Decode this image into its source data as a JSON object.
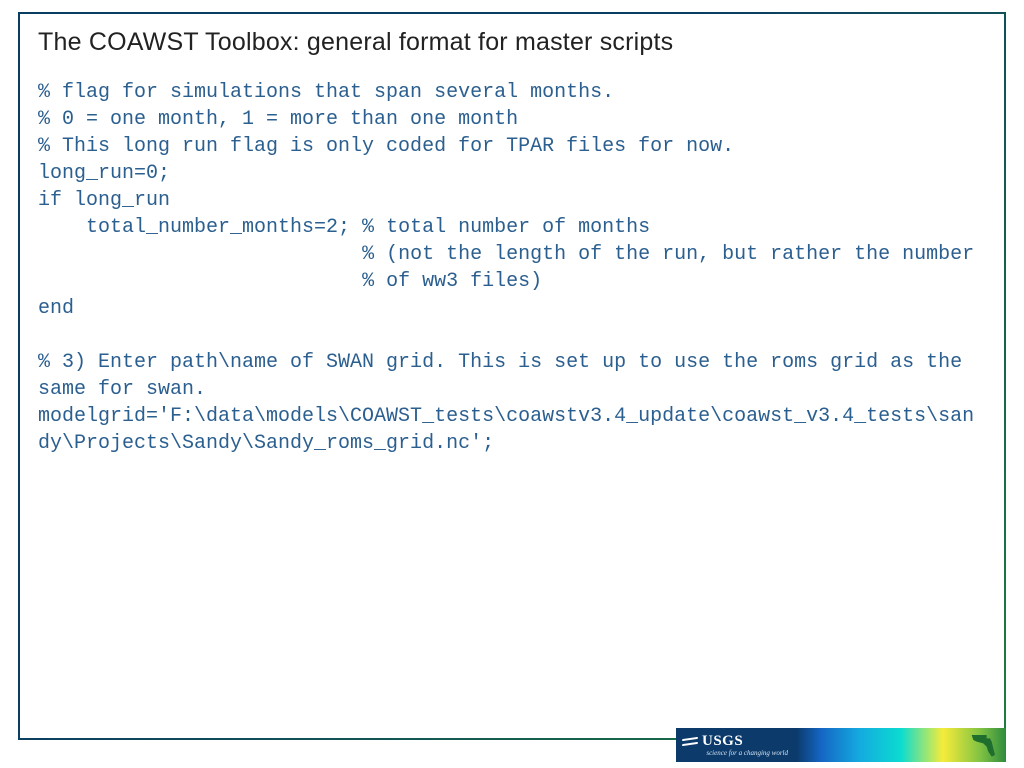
{
  "title": "The COAWST Toolbox: general format for master scripts",
  "code": {
    "l01": "% flag for simulations that span several months.",
    "l02": "% 0 = one month, 1 = more than one month",
    "l03": "% This long run flag is only coded for TPAR files for now.",
    "l04": "long_run=0;",
    "l05": "if long_run",
    "l06": "    total_number_months=2; % total number of months",
    "l07": "                           % (not the length of the run, but rather the number",
    "l08": "                           % of ww3 files)",
    "l09": "end",
    "l10": "",
    "l11": "% 3) Enter path\\name of SWAN grid. This is set up to use the roms grid as the same for swan.",
    "l12": "modelgrid='F:\\data\\models\\COAWST_tests\\coawstv3.4_update\\coawst_v3.4_tests\\sandy\\Projects\\Sandy\\Sandy_roms_grid.nc';"
  },
  "footer": {
    "usgs": "USGS",
    "tagline": "science for a changing world"
  }
}
